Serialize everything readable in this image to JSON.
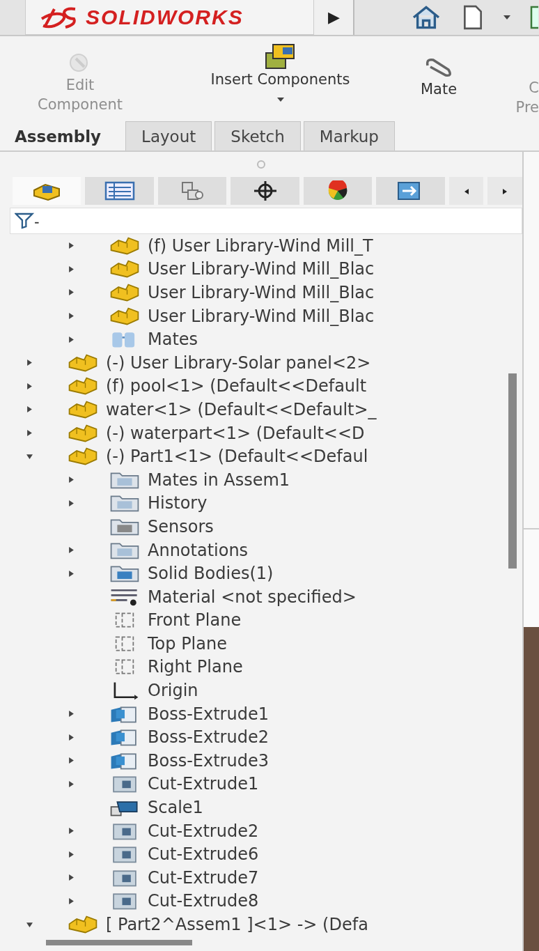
{
  "app_bar": {
    "logo": "**SOLID**WORKS",
    "expand_arrow": "▶"
  },
  "ribbon": {
    "buttons": [
      {
        "kind": "edit",
        "lines": [
          "Edit",
          "Component"
        ],
        "disabled": true
      },
      {
        "kind": "insert",
        "lines": [
          "Insert Components"
        ],
        "disabled": false,
        "caret": true
      },
      {
        "kind": "mate",
        "lines": [
          "Mate"
        ],
        "disabled": false
      },
      {
        "kind": "partial",
        "lines": [
          "C",
          "Pre"
        ],
        "disabled": true
      }
    ]
  },
  "tabs": [
    {
      "label": "Assembly",
      "selected": true
    },
    {
      "label": "Layout",
      "selected": false
    },
    {
      "label": "Sketch",
      "selected": false
    },
    {
      "label": "Markup",
      "selected": false
    }
  ],
  "manager_tabs": [
    {
      "kind": "feature",
      "selected": true
    },
    {
      "kind": "property",
      "selected": false
    },
    {
      "kind": "config",
      "selected": false
    },
    {
      "kind": "dim",
      "selected": false
    },
    {
      "kind": "display",
      "selected": false
    },
    {
      "kind": "cam",
      "selected": false
    }
  ],
  "tree": {
    "partial_children": [
      {
        "label": "(f) User Library-Wind Mill_T",
        "kind": "component",
        "expanded": false
      },
      {
        "label": "User Library-Wind Mill_Blac",
        "kind": "component",
        "expanded": false
      },
      {
        "label": "User Library-Wind Mill_Blac",
        "kind": "component",
        "expanded": false
      },
      {
        "label": "User Library-Wind Mill_Blac",
        "kind": "component",
        "expanded": false
      },
      {
        "label": "Mates",
        "kind": "mates",
        "expanded": false
      }
    ],
    "items": [
      {
        "label": "(-) User Library-Solar panel<2>",
        "kind": "component",
        "expanded": false
      },
      {
        "label": "(f) pool<1> (Default<<Default",
        "kind": "component",
        "expanded": false
      },
      {
        "label": "water<1> (Default<<Default>_",
        "kind": "component",
        "expanded": false
      },
      {
        "label": "(-) waterpart<1> (Default<<D",
        "kind": "component",
        "expanded": false
      },
      {
        "label": "(-) Part1<1> (Default<<Defaul",
        "kind": "component",
        "expanded": true,
        "children": [
          {
            "label": "Mates in Assem1",
            "kind": "folder-mates",
            "expanded": false
          },
          {
            "label": "History",
            "kind": "folder-history",
            "expanded": false
          },
          {
            "label": "Sensors",
            "kind": "folder-sensors"
          },
          {
            "label": "Annotations",
            "kind": "folder-annotations",
            "expanded": false
          },
          {
            "label": "Solid Bodies(1)",
            "kind": "folder-bodies",
            "expanded": false
          },
          {
            "label": "Material <not specified>",
            "kind": "material"
          },
          {
            "label": "Front Plane",
            "kind": "plane"
          },
          {
            "label": "Top Plane",
            "kind": "plane"
          },
          {
            "label": "Right Plane",
            "kind": "plane"
          },
          {
            "label": "Origin",
            "kind": "origin"
          },
          {
            "label": "Boss-Extrude1",
            "kind": "boss",
            "expanded": false
          },
          {
            "label": "Boss-Extrude2",
            "kind": "boss",
            "expanded": false
          },
          {
            "label": "Boss-Extrude3",
            "kind": "boss",
            "expanded": false
          },
          {
            "label": "Cut-Extrude1",
            "kind": "cut",
            "expanded": false
          },
          {
            "label": "Scale1",
            "kind": "scale"
          },
          {
            "label": "Cut-Extrude2",
            "kind": "cut",
            "expanded": false
          },
          {
            "label": "Cut-Extrude6",
            "kind": "cut",
            "expanded": false
          },
          {
            "label": "Cut-Extrude7",
            "kind": "cut",
            "expanded": false
          },
          {
            "label": "Cut-Extrude8",
            "kind": "cut",
            "expanded": false
          }
        ]
      },
      {
        "label": "[ Part2^Assem1 ]<1> -> (Defa",
        "kind": "component",
        "expanded": true
      }
    ]
  }
}
